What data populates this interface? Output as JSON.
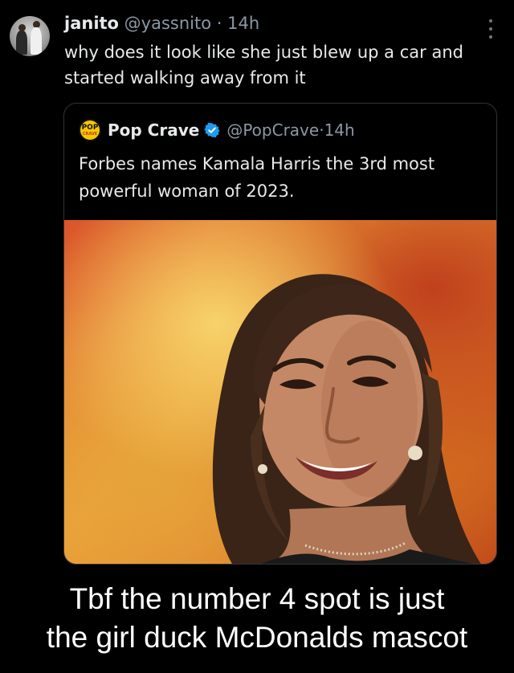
{
  "tweet": {
    "author_name": "janito",
    "author_handle": "@yassnito",
    "separator": "·",
    "time": "14h",
    "text": "why does it look like she just blew up a car and started walking away from it"
  },
  "quoted_tweet": {
    "author_name": "Pop Crave",
    "author_handle": "@PopCrave",
    "separator": "·",
    "time": "14h",
    "verified": true,
    "logo_text_top": "POP",
    "logo_text_bottom": "CRAVE",
    "text": "Forbes names Kamala Harris the 3rd most powerful woman of 2023."
  },
  "caption": {
    "line1": "Tbf the number 4 spot is just",
    "line2": "the girl duck McDonalds mascot"
  },
  "colors": {
    "background": "#000000",
    "text_primary": "#e7e9ea",
    "text_secondary": "#8b98a5",
    "verified_blue": "#1d9bf0",
    "card_border": "#2f3336"
  },
  "icons": {
    "more": "more-vertical-icon",
    "verified": "verified-badge-icon"
  }
}
